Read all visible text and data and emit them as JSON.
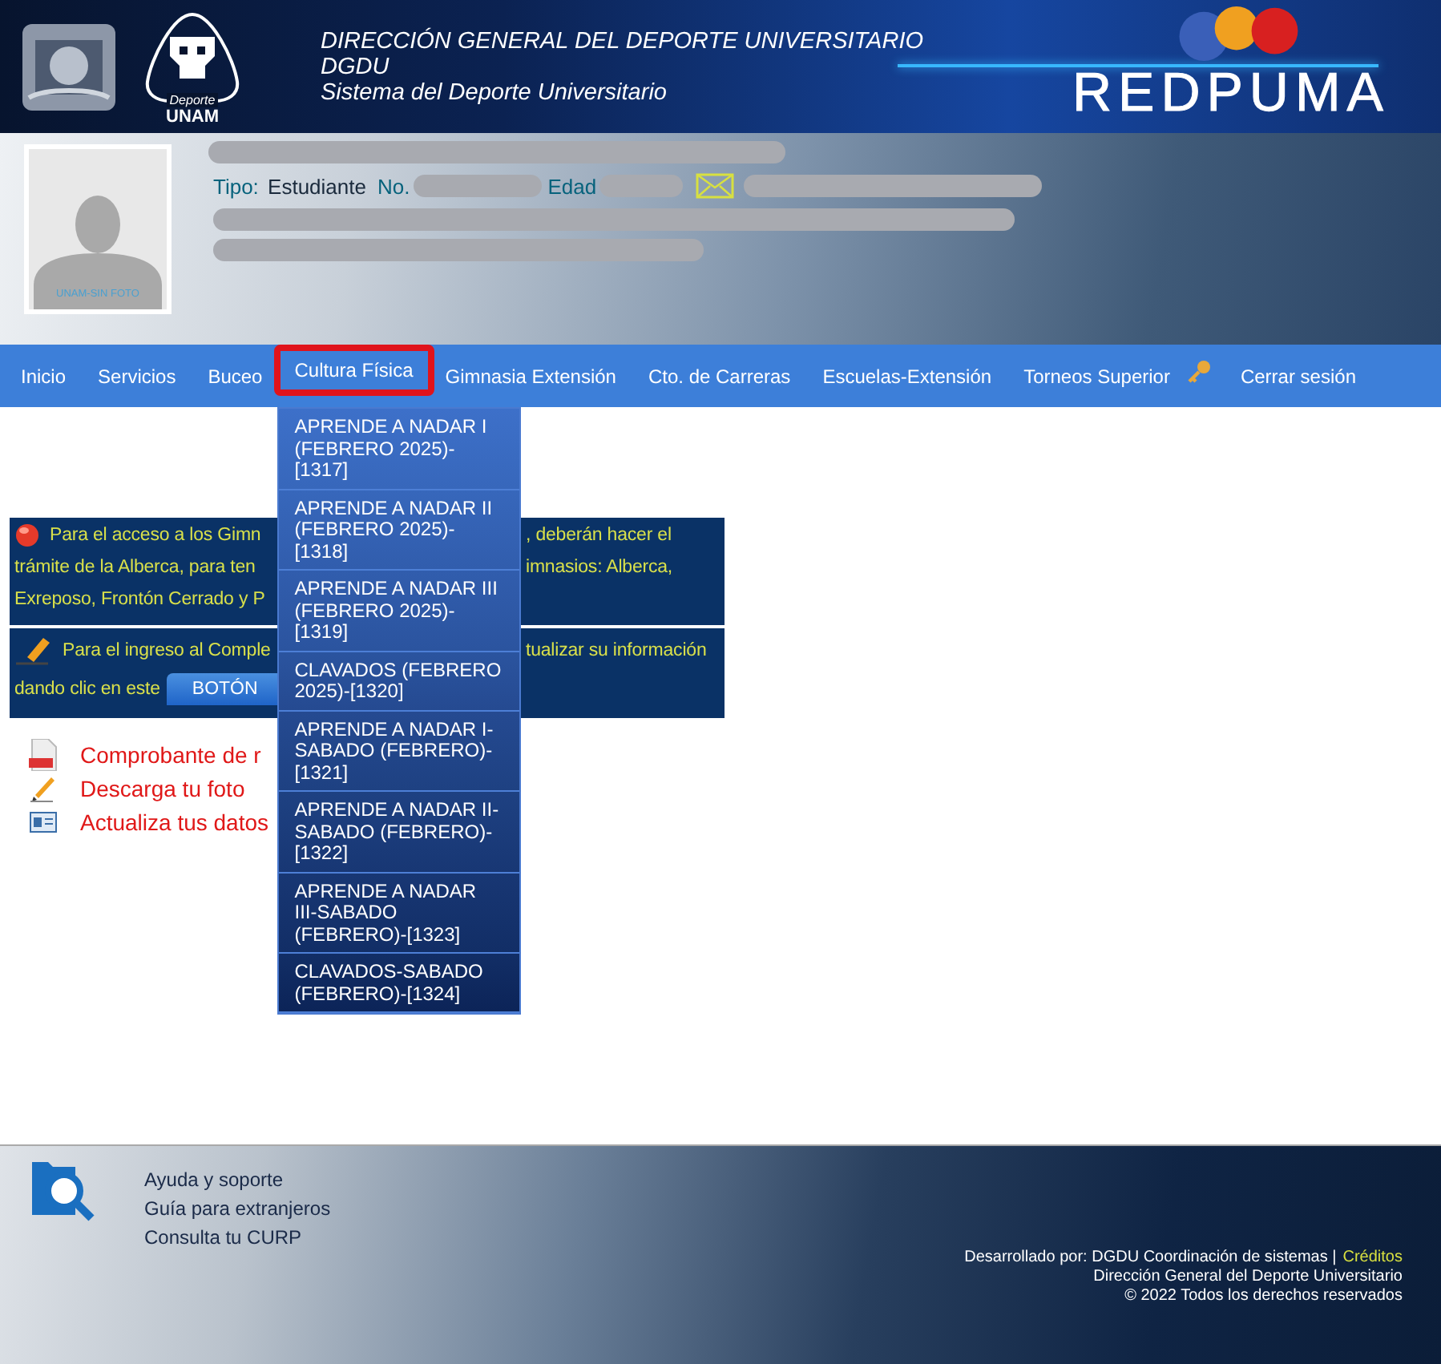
{
  "header": {
    "titles": [
      "DIRECCIÓN GENERAL DEL DEPORTE UNIVERSITARIO",
      "DGDU",
      "Sistema del Deporte Universitario"
    ],
    "logo_caption": "Deporte",
    "logo_name": "UNAM",
    "brand": "REDPUMA"
  },
  "profile": {
    "photo_caption": "UNAM-SIN FOTO",
    "type_label": "Tipo:",
    "type_value": "Estudiante",
    "number_label": "No.",
    "age_label": "Edad"
  },
  "nav": [
    {
      "label": "Inicio",
      "kind": "link",
      "selected": false
    },
    {
      "label": "Servicios",
      "kind": "link",
      "selected": false
    },
    {
      "label": "Buceo",
      "kind": "link",
      "selected": false
    },
    {
      "label": "Cultura Física",
      "kind": "link",
      "selected": true
    },
    {
      "label": "Gimnasia Extensión",
      "kind": "link",
      "selected": false
    },
    {
      "label": "Cto. de Carreras",
      "kind": "link",
      "selected": false
    },
    {
      "label": "Escuelas-Extensión",
      "kind": "link",
      "selected": false
    },
    {
      "label": "Torneos Superior",
      "kind": "link",
      "selected": false
    },
    {
      "label": "Cerrar sesión",
      "kind": "logout",
      "selected": false
    }
  ],
  "dropdown": [
    "APRENDE A NADAR I (FEBRERO 2025)-[1317]",
    "APRENDE A NADAR II (FEBRERO 2025)-[1318]",
    "APRENDE A NADAR III (FEBRERO 2025)-[1319]",
    "CLAVADOS (FEBRERO 2025)-[1320]",
    "APRENDE A NADAR I-SABADO (FEBRERO)-[1321]",
    "APRENDE A NADAR II-SABADO (FEBRERO)-[1322]",
    "APRENDE A NADAR III-SABADO (FEBRERO)-[1323]",
    "CLAVADOS-SABADO (FEBRERO)-[1324]"
  ],
  "notices": [
    {
      "kind": "alert",
      "left_lines": [
        "Para el acceso a los Gimn",
        "trámite de la Alberca, para ten",
        "Exreposo, Frontón Cerrado y P"
      ],
      "right_lines": [
        ", deberán hacer el",
        "imnasios: Alberca,"
      ]
    },
    {
      "kind": "edit",
      "left_lines": [
        "Para el ingreso al Comple",
        "dando clic en este"
      ],
      "button": "BOTÓN",
      "right_lines": [
        "tualizar su información"
      ]
    }
  ],
  "links": [
    {
      "kind": "pdf",
      "label": "Comprobante de r"
    },
    {
      "kind": "pencil",
      "label": "Descarga tu foto"
    },
    {
      "kind": "card",
      "label": "Actualiza tus datos"
    }
  ],
  "footer": {
    "links": [
      "Ayuda y soporte",
      "Guía para extranjeros",
      "Consulta tu CURP"
    ],
    "developed": "Desarrollado por: DGDU Coordinación de sistemas |",
    "credits": "Créditos",
    "lines": [
      "Dirección General del Deporte Universitario",
      "© 2022 Todos los derechos reservados"
    ]
  }
}
